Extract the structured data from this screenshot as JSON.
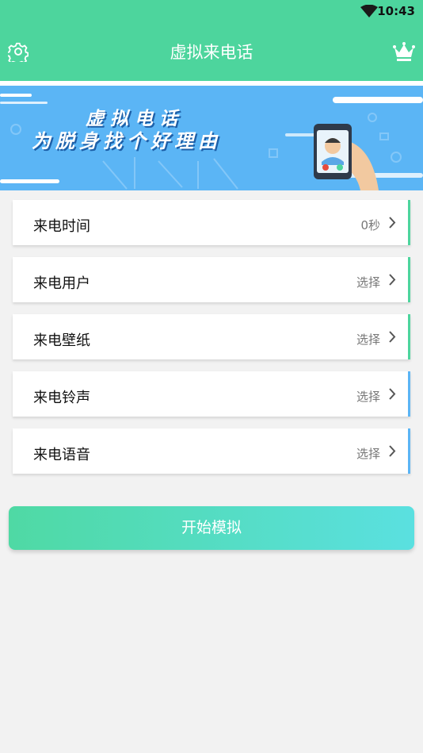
{
  "status_bar": {
    "time": "10:43"
  },
  "app_bar": {
    "title": "虚拟来电话",
    "settings_icon": "gear-icon",
    "vip_icon": "crown-icon"
  },
  "banner": {
    "line1": "虚拟电话",
    "line2": "为脱身找个好理由"
  },
  "settings": [
    {
      "label": "来电时间",
      "value": "0秒",
      "accent": "#4dd59d"
    },
    {
      "label": "来电用户",
      "value": "选择",
      "accent": "#4dd59d"
    },
    {
      "label": "来电壁纸",
      "value": "选择",
      "accent": "#4dd59d"
    },
    {
      "label": "来电铃声",
      "value": "选择",
      "accent": "#5bb5f5"
    },
    {
      "label": "来电语音",
      "value": "选择",
      "accent": "#5bb5f5"
    }
  ],
  "start_button": {
    "label": "开始模拟"
  },
  "colors": {
    "primary": "#4dd59d",
    "banner": "#5bb5f5"
  }
}
